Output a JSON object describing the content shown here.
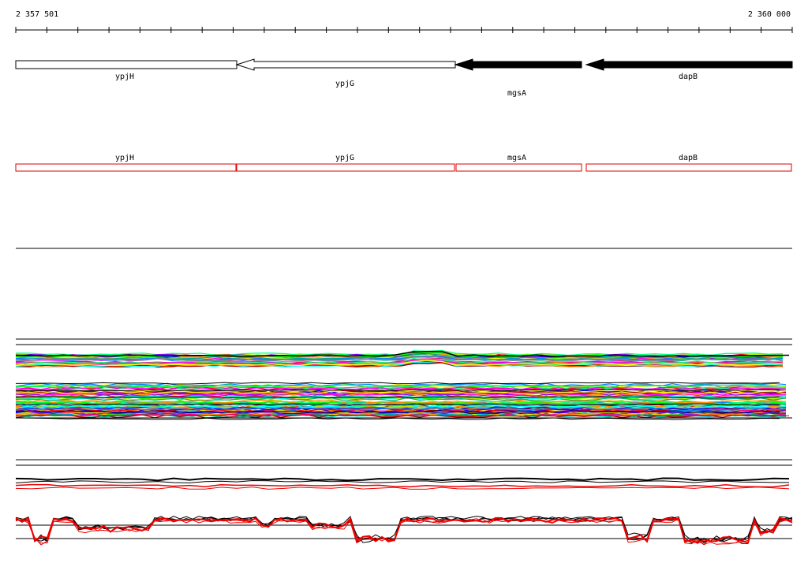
{
  "ruler": {
    "start_label": "2 357 501",
    "end_label": "2 360 000"
  },
  "genes": [
    {
      "name": "ypjH",
      "strand": "-",
      "filled": false
    },
    {
      "name": "ypjG",
      "strand": "-",
      "filled": false
    },
    {
      "name": "mgsA",
      "strand": "-",
      "filled": true
    },
    {
      "name": "dapB",
      "strand": "-",
      "filled": true
    }
  ],
  "annotation_boxes": [
    {
      "label": "ypjH"
    },
    {
      "label": "ypjG"
    },
    {
      "label": "mgsA"
    },
    {
      "label": "dapB"
    }
  ],
  "colors": {
    "gene_fill": "#000000",
    "annotation_box": "#dd0000",
    "track_black": "#000000",
    "track_red": "#ee0000"
  }
}
